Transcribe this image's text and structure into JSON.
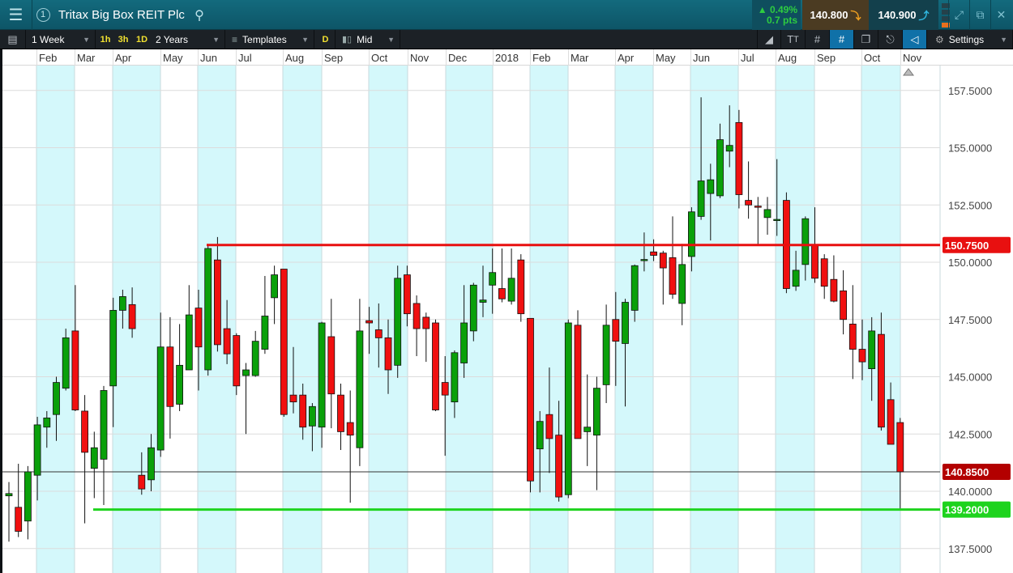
{
  "header": {
    "title": "Tritax Big Box REIT Plc",
    "instance_number": "1",
    "change_pct": "▲ 0.49%",
    "change_pts": "0.7 pts",
    "sell_price": "140.800",
    "buy_price": "140.900"
  },
  "toolbar": {
    "interval": "1 Week",
    "quick_1h": "1h",
    "quick_3h": "3h",
    "quick_1d": "1D",
    "range": "2 Years",
    "templates": "Templates",
    "d_label": "D",
    "price_type": "Mid",
    "settings": "Settings"
  },
  "months": [
    "Feb",
    "Mar",
    "Apr",
    "May",
    "Jun",
    "Jul",
    "Aug",
    "Sep",
    "Oct",
    "Nov",
    "Dec",
    "2018",
    "Feb",
    "Mar",
    "Apr",
    "May",
    "Jun",
    "Jul",
    "Aug",
    "Sep",
    "Oct",
    "Nov"
  ],
  "chart_data": {
    "type": "candlestick",
    "interval": "weekly",
    "ylim": [
      137.0,
      158.5
    ],
    "y_ticks": [
      "157.5000",
      "155.0000",
      "152.5000",
      "150.0000",
      "147.5000",
      "145.0000",
      "142.5000",
      "140.0000",
      "137.5000"
    ],
    "y_tick_values": [
      157.5,
      155,
      152.5,
      150,
      147.5,
      145,
      142.5,
      140,
      137.5
    ],
    "resistance": {
      "value": 150.75,
      "label": "150.7500",
      "color": "#e81010"
    },
    "support": {
      "value": 139.2,
      "label": "139.2000",
      "color": "#1ed31e"
    },
    "current": {
      "value": 140.85,
      "label": "140.8500",
      "color": "#b30000"
    },
    "up_color": "#0aa00a",
    "down_color": "#f01010",
    "ohlc": [
      [
        139.8,
        140.4,
        137.8,
        139.9
      ],
      [
        139.3,
        141.2,
        138.0,
        138.25
      ],
      [
        138.7,
        141.1,
        137.9,
        140.85
      ],
      [
        140.7,
        143.25,
        139.6,
        142.9
      ],
      [
        142.8,
        143.5,
        141.9,
        143.2
      ],
      [
        143.35,
        145.0,
        142.2,
        144.75
      ],
      [
        144.5,
        147.1,
        144.4,
        146.7
      ],
      [
        147.0,
        149.0,
        143.5,
        143.55
      ],
      [
        143.5,
        144.2,
        138.6,
        141.7
      ],
      [
        141.0,
        142.6,
        139.7,
        141.9
      ],
      [
        141.4,
        144.6,
        139.4,
        144.4
      ],
      [
        144.6,
        148.45,
        142.8,
        147.9
      ],
      [
        147.9,
        148.8,
        147.1,
        148.5
      ],
      [
        148.15,
        148.9,
        146.7,
        147.1
      ],
      [
        140.7,
        141.7,
        139.85,
        140.1
      ],
      [
        140.5,
        142.5,
        140.0,
        141.9
      ],
      [
        141.8,
        147.8,
        141.5,
        146.3
      ],
      [
        146.3,
        147.6,
        142.3,
        143.7
      ],
      [
        143.8,
        147.3,
        143.5,
        145.5
      ],
      [
        145.3,
        149.0,
        145.3,
        147.7
      ],
      [
        148.0,
        148.8,
        144.4,
        146.3
      ],
      [
        145.3,
        150.8,
        145.05,
        150.6
      ],
      [
        150.1,
        151.1,
        146.1,
        146.4
      ],
      [
        147.1,
        148.35,
        145.55,
        146.0
      ],
      [
        146.8,
        146.9,
        144.2,
        144.6
      ],
      [
        145.05,
        145.6,
        142.5,
        145.3
      ],
      [
        145.05,
        147.0,
        145.0,
        146.55
      ],
      [
        146.2,
        149.4,
        146.0,
        147.65
      ],
      [
        148.45,
        149.85,
        147.3,
        149.45
      ],
      [
        149.7,
        149.7,
        143.25,
        143.35
      ],
      [
        144.2,
        146.3,
        143.4,
        143.9
      ],
      [
        144.2,
        144.7,
        142.25,
        142.8
      ],
      [
        142.85,
        143.85,
        141.75,
        143.7
      ],
      [
        142.8,
        147.4,
        141.9,
        147.35
      ],
      [
        146.75,
        148.4,
        142.75,
        144.25
      ],
      [
        144.2,
        144.7,
        141.8,
        142.6
      ],
      [
        143.0,
        144.4,
        139.5,
        142.45
      ],
      [
        141.9,
        148.4,
        141.1,
        147.0
      ],
      [
        147.45,
        148.05,
        146.0,
        147.35
      ],
      [
        147.05,
        148.2,
        145.4,
        146.7
      ],
      [
        146.7,
        147.5,
        144.25,
        145.3
      ],
      [
        145.5,
        149.85,
        144.95,
        149.3
      ],
      [
        149.45,
        149.85,
        147.2,
        147.75
      ],
      [
        148.2,
        148.55,
        145.9,
        147.1
      ],
      [
        147.6,
        147.8,
        145.65,
        147.1
      ],
      [
        147.35,
        147.5,
        143.5,
        143.55
      ],
      [
        144.75,
        145.9,
        141.55,
        144.2
      ],
      [
        143.9,
        146.15,
        143.2,
        146.05
      ],
      [
        145.6,
        149.0,
        144.95,
        147.35
      ],
      [
        147.0,
        149.1,
        146.55,
        149.0
      ],
      [
        148.25,
        149.85,
        147.6,
        148.35
      ],
      [
        149.0,
        150.6,
        147.75,
        149.55
      ],
      [
        148.85,
        150.6,
        148.25,
        148.4
      ],
      [
        148.3,
        150.6,
        148.15,
        149.3
      ],
      [
        150.1,
        150.35,
        147.4,
        147.75
      ],
      [
        147.55,
        147.55,
        139.95,
        140.45
      ],
      [
        141.85,
        143.5,
        139.95,
        143.05
      ],
      [
        143.35,
        145.4,
        140.8,
        142.3
      ],
      [
        142.45,
        143.95,
        139.55,
        139.75
      ],
      [
        139.85,
        147.5,
        139.7,
        147.35
      ],
      [
        147.25,
        147.9,
        142.3,
        142.3
      ],
      [
        142.6,
        145.1,
        141.1,
        142.8
      ],
      [
        142.45,
        145.0,
        140.05,
        144.5
      ],
      [
        144.65,
        148.15,
        143.85,
        147.25
      ],
      [
        147.5,
        148.7,
        144.6,
        146.55
      ],
      [
        146.45,
        148.4,
        143.7,
        148.25
      ],
      [
        147.9,
        149.9,
        147.4,
        149.85
      ],
      [
        150.1,
        151.3,
        149.6,
        150.12
      ],
      [
        150.45,
        151.0,
        150.05,
        150.3
      ],
      [
        150.4,
        150.5,
        148.15,
        149.75
      ],
      [
        150.2,
        152.0,
        148.4,
        148.6
      ],
      [
        148.2,
        150.8,
        147.25,
        149.9
      ],
      [
        150.25,
        152.4,
        149.6,
        152.2
      ],
      [
        152.0,
        157.2,
        151.85,
        153.55
      ],
      [
        153.0,
        154.3,
        150.95,
        153.6
      ],
      [
        152.9,
        156.05,
        152.8,
        155.35
      ],
      [
        154.85,
        156.85,
        154.15,
        155.1
      ],
      [
        156.1,
        156.65,
        152.35,
        152.95
      ],
      [
        152.7,
        154.4,
        151.9,
        152.5
      ],
      [
        152.45,
        152.85,
        150.75,
        152.4
      ],
      [
        151.95,
        152.85,
        151.2,
        152.3
      ],
      [
        151.85,
        154.5,
        151.15,
        151.87
      ],
      [
        152.7,
        153.05,
        148.65,
        148.85
      ],
      [
        148.95,
        150.5,
        148.75,
        149.65
      ],
      [
        149.9,
        152.0,
        149.2,
        151.9
      ],
      [
        150.75,
        152.4,
        149.1,
        149.3
      ],
      [
        150.15,
        150.35,
        148.4,
        148.95
      ],
      [
        149.25,
        150.3,
        148.25,
        148.3
      ],
      [
        148.75,
        149.65,
        146.85,
        147.5
      ],
      [
        147.3,
        149.0,
        144.9,
        146.2
      ],
      [
        146.2,
        147.5,
        144.85,
        145.65
      ],
      [
        145.35,
        147.6,
        143.95,
        147.0
      ],
      [
        146.85,
        147.8,
        142.65,
        142.8
      ],
      [
        144.0,
        144.75,
        142.05,
        142.05
      ],
      [
        143.0,
        143.2,
        139.2,
        140.85
      ]
    ]
  }
}
